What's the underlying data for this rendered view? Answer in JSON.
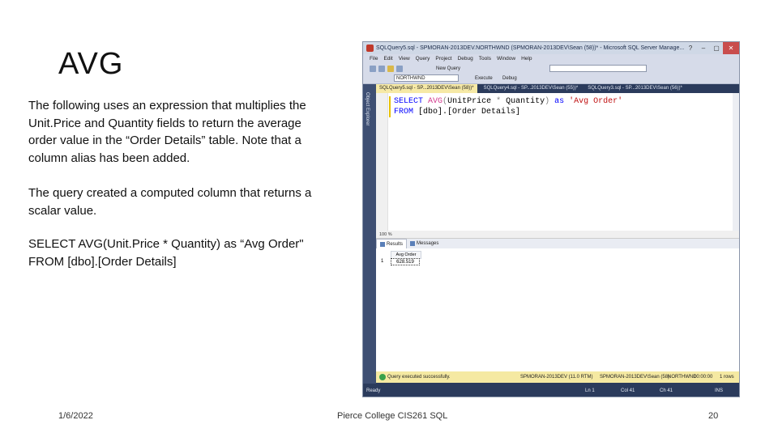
{
  "slide": {
    "title": "AVG",
    "paragraph1": "The following uses an expression that multiplies the Unit.Price and Quantity fields to return the average order value in the “Order Details” table. Note that a column alias has been added.",
    "paragraph2": "The query created a computed column that returns a scalar value.",
    "query_line1": "SELECT AVG(Unit.Price * Quantity) as “Avg Order\"",
    "query_line2": "FROM [dbo].[Order Details]",
    "footer_date": "1/6/2022",
    "footer_center": "Pierce College CIS261 SQL",
    "footer_page": "20"
  },
  "ssms": {
    "title": "SQLQuery5.sql - SPMORAN-2013DEV.NORTHWND (SPMORAN-2013DEV\\Sean (58))* - Microsoft SQL Server Manage...",
    "window_buttons": [
      "?",
      "–",
      "▢",
      "✕"
    ],
    "menu": [
      "File",
      "Edit",
      "View",
      "Query",
      "Project",
      "Debug",
      "Tools",
      "Window",
      "Help"
    ],
    "new_query_label": "New Query",
    "database": "NORTHWND",
    "execute_label": "Execute",
    "debug_label": "Debug",
    "sidebar_label": "Object Explorer",
    "tabs": [
      "SQLQuery5.sql - SP...2013DEV\\Sean (58))*",
      "SQLQuery4.sql - SP...2013DEV\\Sean (55))*",
      "SQLQuery3.sql - SP...2013DEV\\Sean (56))*"
    ],
    "code": {
      "select": "SELECT",
      "avg": "AVG",
      "open": "(",
      "unitprice": "UnitPrice",
      "star": " * ",
      "quantity": "Quantity",
      "close": ")",
      "as": "as",
      "alias": "'Avg Order'",
      "from": "FROM",
      "table": "[dbo].[Order Details]"
    },
    "zoom": "100 %",
    "result_tabs": [
      "Results",
      "Messages"
    ],
    "grid": {
      "column": "Avg Order",
      "row_number": "1",
      "value": "628.519"
    },
    "status": {
      "message": "Query executed successfully.",
      "server": "SPMORAN-2013DEV (11.0 RTM)",
      "user": "SPMORAN-2013DEV\\Sean (58)",
      "db": "NORTHWND",
      "time": "00:00:00",
      "rows": "1 rows"
    },
    "bottom": {
      "state": "Ready",
      "ln": "Ln 1",
      "col": "Col 41",
      "ch": "Ch 41",
      "mode": "INS"
    }
  }
}
